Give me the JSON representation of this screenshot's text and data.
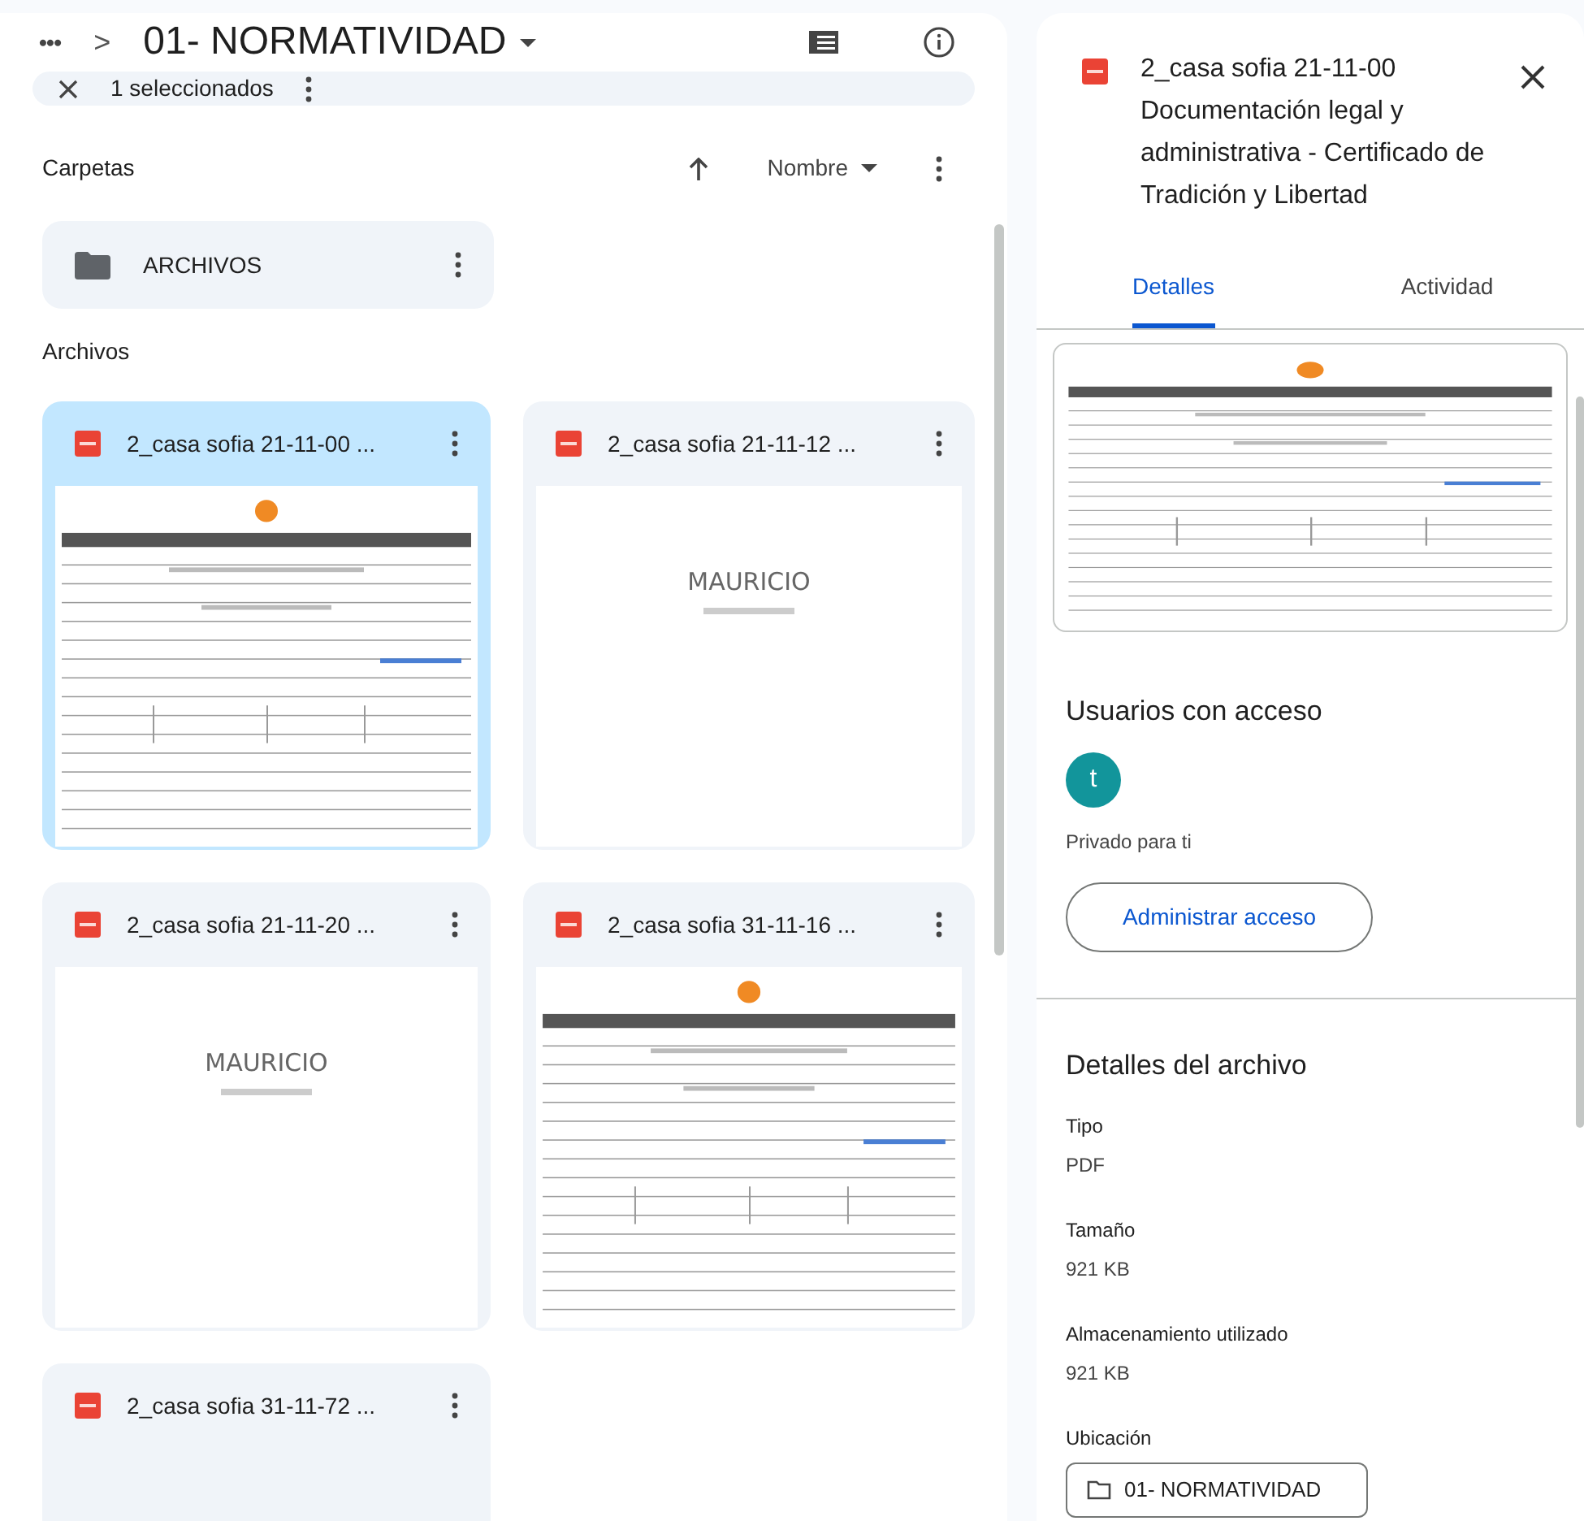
{
  "breadcrumb": {
    "more": "•••",
    "separator": ">",
    "folder": "01- NORMATIVIDAD"
  },
  "selection_bar": {
    "count": "1 seleccionados"
  },
  "folders_section": {
    "title": "Carpetas",
    "sort": "Nombre"
  },
  "folders": [
    {
      "name": "ARCHIVOS"
    }
  ],
  "files_section": {
    "title": "Archivos"
  },
  "files": [
    {
      "name": "2_casa sofia 21-11-00 ...",
      "selected": true,
      "kind": "form"
    },
    {
      "name": "2_casa sofia 21-11-12 ...",
      "selected": false,
      "kind": "cover",
      "cover_title": "MAURICIO"
    },
    {
      "name": "2_casa sofia 21-11-20 ...",
      "selected": false,
      "kind": "cover",
      "cover_title": "MAURICIO"
    },
    {
      "name": "2_casa sofia 31-11-16 ...",
      "selected": false,
      "kind": "form"
    },
    {
      "name": "2_casa sofia 31-11-72 ...",
      "selected": false,
      "kind": "none"
    }
  ],
  "details": {
    "title": "2_casa sofia 21-11-00 Documentación legal y administrativa - Certificado de Tradición y Libertad",
    "tabs": [
      {
        "label": "Detalles",
        "selected": true
      },
      {
        "label": "Actividad",
        "selected": false
      }
    ],
    "access_title": "Usuarios con acceso",
    "avatar": "t",
    "privacy": "Privado para ti",
    "manage_button": "Administrar acceso",
    "file_details_title": "Detalles del archivo",
    "fields": [
      {
        "label": "Tipo",
        "value": "PDF"
      },
      {
        "label": "Tamaño",
        "value": "921 KB"
      },
      {
        "label": "Almacenamiento utilizado",
        "value": "921 KB"
      }
    ],
    "location_label": "Ubicación",
    "location": "01- NORMATIVIDAD"
  }
}
